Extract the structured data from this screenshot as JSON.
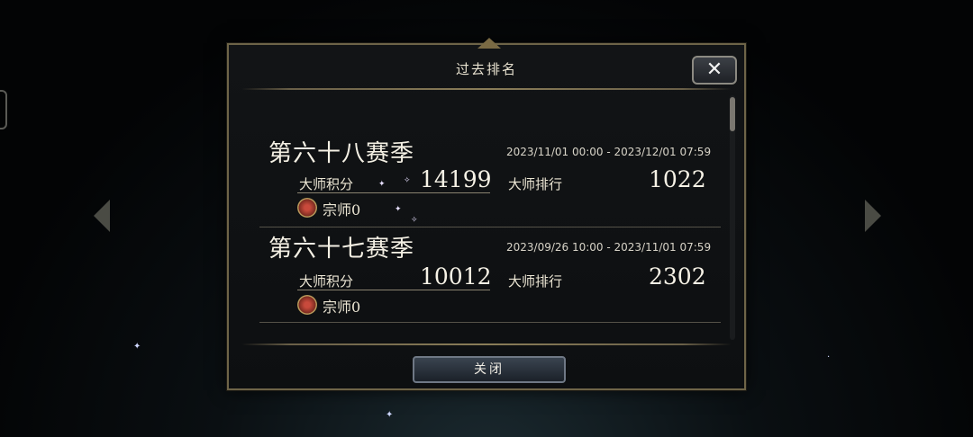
{
  "dialog": {
    "title": "过去排名",
    "close_button": "关闭",
    "close_icon": "close-x-icon"
  },
  "seasons": [
    {
      "name": "第六十八赛季",
      "time_range": "2023/11/01 00:00 - 2023/12/01 07:59",
      "score_label": "大师积分",
      "score": "14199",
      "rank_label": "大师排行",
      "rank": "1022",
      "title": "宗师0"
    },
    {
      "name": "第六十七赛季",
      "time_range": "2023/09/26 10:00 - 2023/11/01 07:59",
      "score_label": "大师积分",
      "score": "10012",
      "rank_label": "大师排行",
      "rank": "2302",
      "title": "宗师0"
    }
  ],
  "colors": {
    "panel_border": "#6e6448",
    "panel_bg": "#121416",
    "text": "#ece6d4"
  }
}
